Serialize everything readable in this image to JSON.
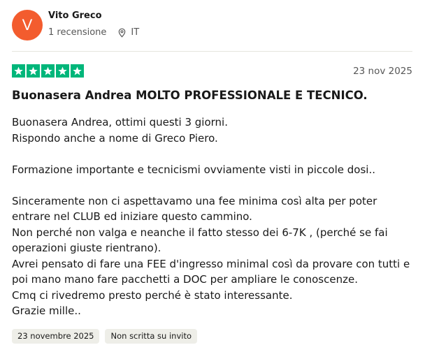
{
  "consumer": {
    "avatar_initial": "V",
    "avatar_color": "#f35c2e",
    "name": "Vito Greco",
    "review_count": "1 recensione",
    "country": "IT",
    "location_icon": "location-pin-icon"
  },
  "review": {
    "rating": 5,
    "rating_max": 5,
    "star_color": "#00b67a",
    "date": "23 nov 2025",
    "title": "Buonasera Andrea MOLTO PROFESSIONALE E TECNICO.",
    "body": [
      "Buonasera Andrea, ottimi questi 3 giorni.",
      "Rispondo anche a nome di Greco Piero.",
      "",
      "Formazione importante e tecnicismi ovviamente visti in piccole dosi..",
      "",
      "Sinceramente non ci aspettavamo una fee minima così alta per poter entrare nel CLUB ed iniziare questo cammino.",
      "Non perché non valga e neanche il fatto stesso dei 6-7K , (perché se fai operazioni giuste rientrano).",
      "Avrei pensato di fare una FEE d'ingresso minimal così da provare con tutti e poi mano mano fare pacchetti a DOC per ampliare le conoscenze.",
      "Cmq ci rivedremo presto perché è stato interessante.",
      "Grazie mille.."
    ],
    "tags": [
      "23 novembre 2025",
      "Non scritta su invito"
    ]
  }
}
